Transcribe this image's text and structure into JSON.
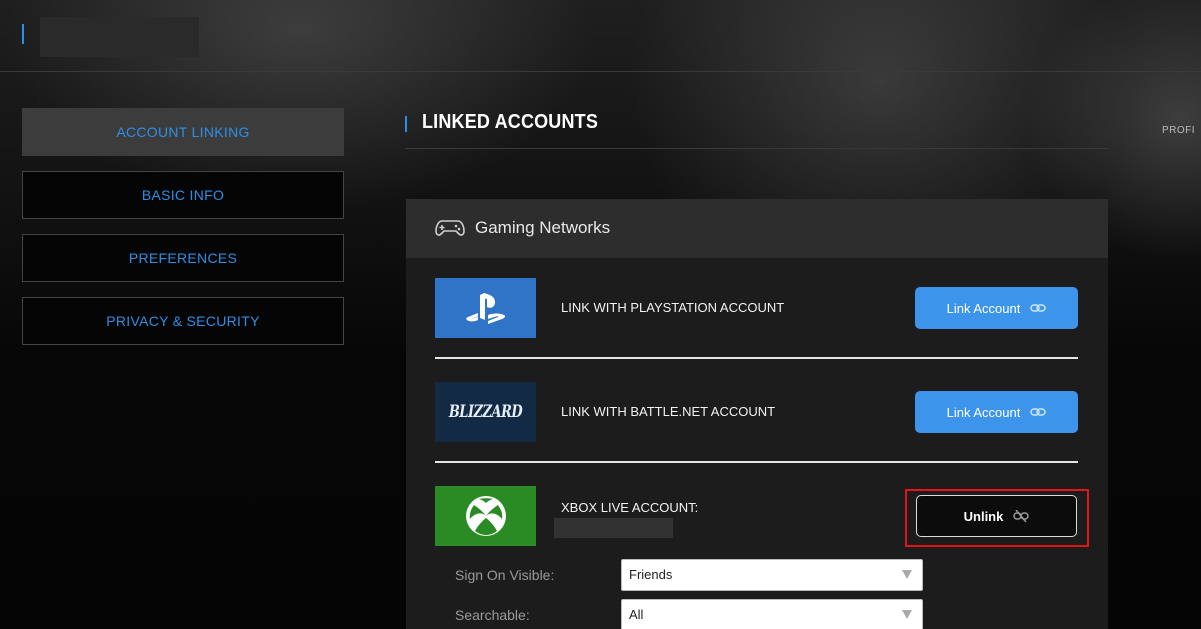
{
  "nav": {
    "items": [
      {
        "label": "ACCOUNT LINKING",
        "active": true
      },
      {
        "label": "BASIC INFO",
        "active": false
      },
      {
        "label": "PREFERENCES",
        "active": false
      },
      {
        "label": "PRIVACY & SECURITY",
        "active": false
      }
    ]
  },
  "section": {
    "title": "LINKED ACCOUNTS"
  },
  "profile_tag": "PROFI",
  "panel": {
    "header_title": "Gaming Networks",
    "header_icon": "gamepad-icon"
  },
  "networks": {
    "playstation": {
      "label": "LINK WITH PLAYSTATION ACCOUNT",
      "button": "Link Account",
      "logo": "playstation-icon"
    },
    "battlenet": {
      "label": "LINK WITH BATTLE.NET ACCOUNT",
      "button": "Link Account",
      "logo": "blizzard-logo",
      "logo_text": "BLIZZARD"
    },
    "xbox": {
      "label": "XBOX LIVE ACCOUNT:",
      "button": "Unlink",
      "logo": "xbox-icon"
    }
  },
  "settings": {
    "sign_on_visible": {
      "label": "Sign On Visible:",
      "value": "Friends"
    },
    "searchable": {
      "label": "Searchable:",
      "value": "All"
    }
  },
  "colors": {
    "accent": "#2d8fe6",
    "link_button": "#3d94eb",
    "playstation": "#2f74c6",
    "blizzard": "#132a45",
    "xbox": "#2a8a23",
    "highlight": "#e3151a"
  }
}
